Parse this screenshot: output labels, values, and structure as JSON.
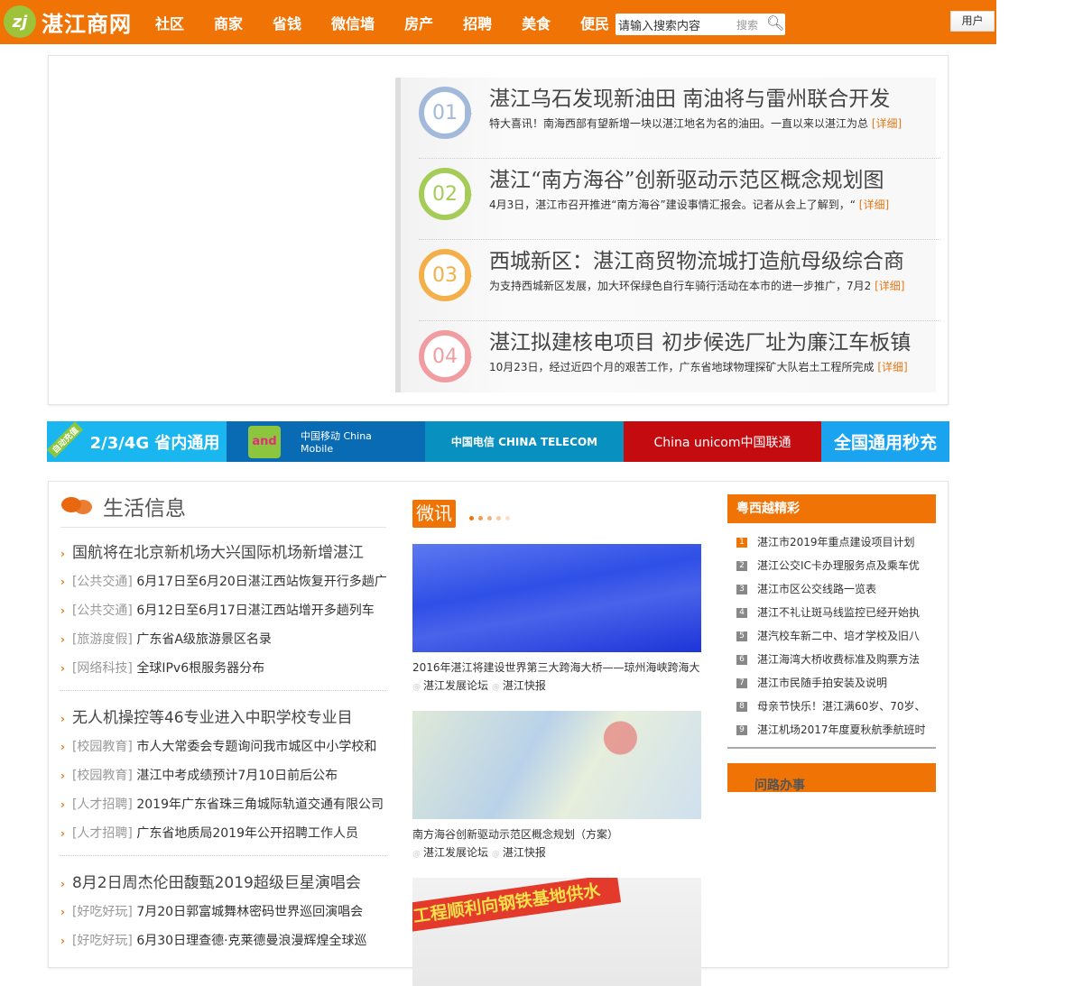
{
  "header": {
    "logo_mark": "zj",
    "site_name": "湛江商网",
    "nav": [
      "社区",
      "商家",
      "省钱",
      "微信墙",
      "房产",
      "招聘",
      "美食",
      "便民"
    ],
    "search_placeholder": "请输入搜索内容",
    "search_button": "搜索",
    "user_button": "用户",
    "accent": "#f07306"
  },
  "featured": [
    {
      "num": "01",
      "color": "#a3b9d9",
      "title": "湛江乌石发现新油田 南油将与雷州联合开发",
      "summary": "特大喜讯！南海西部有望新增一块以湛江地名为名的油田。一直以来以湛江为总",
      "more": "[详细]"
    },
    {
      "num": "02",
      "color": "#a5cc58",
      "title": "湛江“南方海谷”创新驱动示范区概念规划图",
      "summary": "4月3日，湛江市召开推进“南方海谷”建设事情汇报会。记者从会上了解到，“",
      "more": "[详细]"
    },
    {
      "num": "03",
      "color": "#f3b04a",
      "title": "西城新区：湛江商贸物流城打造航母级综合商",
      "summary": "为支持西城新区发展，加大环保绿色自行车骑行活动在本市的进一步推广，7月2",
      "more": "[详细]"
    },
    {
      "num": "04",
      "color": "#f09ca0",
      "title": "湛江拟建核电项目 初步候选厂址为廉江车板镇",
      "summary": "10月23日，经过近四个月的艰苦工作，广东省地球物理探矿大队岩土工程所完成",
      "more": "[详细]"
    }
  ],
  "banner": {
    "tag": "自动充值",
    "items": [
      "2/3/4G 省内通用",
      "and",
      "中国移动 China Mobile",
      "中国电信 CHINA TELECOM",
      "China unicom中国联通",
      "全国通用秒充"
    ]
  },
  "life": {
    "title": "生活信息",
    "groups": [
      {
        "headline": "国航将在北京新机场大兴国际机场新增湛江",
        "items": [
          {
            "cat": "[公共交通]",
            "text": "6月17日至6月20日湛江西站恢复开行多趟广"
          },
          {
            "cat": "[公共交通]",
            "text": "6月12日至6月17日湛江西站增开多趟列车"
          },
          {
            "cat": "[旅游度假]",
            "text": "广东省A级旅游景区名录"
          },
          {
            "cat": "[网络科技]",
            "text": "全球IPv6根服务器分布"
          }
        ]
      },
      {
        "headline": "无人机操控等46专业进入中职学校专业目",
        "items": [
          {
            "cat": "[校园教育]",
            "text": "市人大常委会专题询问我市城区中小学校和"
          },
          {
            "cat": "[校园教育]",
            "text": "湛江中考成绩预计7月10日前后公布"
          },
          {
            "cat": "[人才招聘]",
            "text": "2019年广东省珠三角城际轨道交通有限公司"
          },
          {
            "cat": "[人才招聘]",
            "text": "广东省地质局2019年公开招聘工作人员"
          }
        ]
      },
      {
        "headline": "8月2日周杰伦田馥甄2019超级巨星演唱会",
        "items": [
          {
            "cat": "[好吃好玩]",
            "text": "7月20日郭富城舞林密码世界巡回演唱会"
          },
          {
            "cat": "[好吃好玩]",
            "text": "6月30日理查德·克莱德曼浪漫辉煌全球巡"
          }
        ]
      }
    ]
  },
  "weixun": {
    "title": "微讯",
    "cards": [
      {
        "caption": "2016年湛江将建设世界第三大跨海大桥——琼州海峡跨海大",
        "tags": [
          "湛江发展论坛",
          "湛江快报"
        ]
      },
      {
        "caption": "南方海谷创新驱动示范区概念规划（方案）",
        "tags": [
          "湛江发展论坛",
          "湛江快报"
        ]
      },
      {
        "banner_text": "工程顺利向钢铁基地供水"
      }
    ]
  },
  "right": {
    "title": "粤西越精彩",
    "items": [
      "湛江市2019年重点建设项目计划",
      "湛江公交IC卡办理服务点及乘车优",
      "湛江市区公交线路一览表",
      "湛江不礼让斑马线监控已经开始执",
      "湛汽校车新二中、培才学校及旧八",
      "湛江海湾大桥收费标准及购票方法",
      "湛江市民随手拍安装及说明",
      "母亲节快乐！湛江满60岁、70岁、",
      "湛江机场2017年度夏秋航季航班时"
    ],
    "section2": "问路办事"
  }
}
